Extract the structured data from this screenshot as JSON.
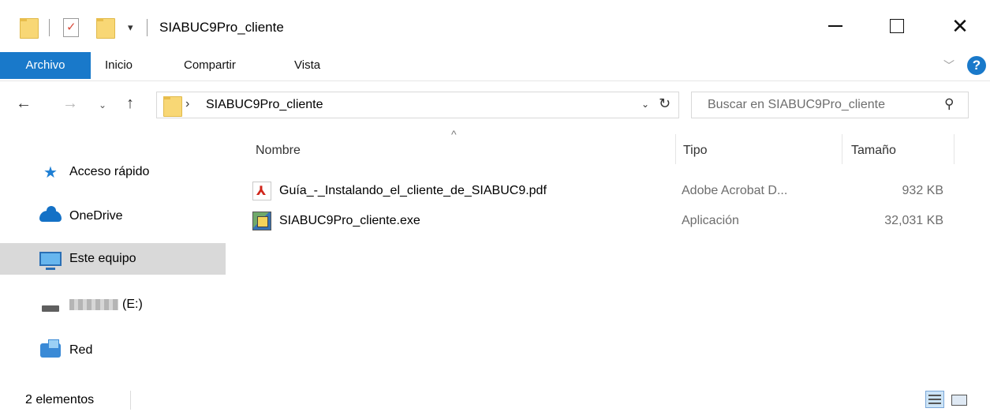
{
  "window": {
    "title": "SIABUC9Pro_cliente",
    "quick_access_dropdown": "▾",
    "minimize": "",
    "maximize": "",
    "close": "✕"
  },
  "ribbon": {
    "tabs": [
      {
        "label": "Archivo"
      },
      {
        "label": "Inicio"
      },
      {
        "label": "Compartir"
      },
      {
        "label": "Vista"
      }
    ],
    "expand": "﹀",
    "help": "?"
  },
  "nav": {
    "back": "←",
    "forward": "→",
    "recent": "⌄",
    "up": "↑",
    "breadcrumb_separator": "›",
    "address": "SIABUC9Pro_cliente",
    "address_dropdown": "⌄",
    "refresh": "↻",
    "search_placeholder": "Buscar en SIABUC9Pro_cliente",
    "search_icon": "⚲"
  },
  "sidebar": {
    "items": [
      {
        "label": "Acceso rápido",
        "icon": "star-icon"
      },
      {
        "label": "OneDrive",
        "icon": "cloud-icon"
      },
      {
        "label": "Este equipo",
        "icon": "computer-icon",
        "selected": true
      },
      {
        "label": "(E:)",
        "icon": "drive-icon"
      },
      {
        "label": "Red",
        "icon": "network-icon"
      }
    ]
  },
  "columns": {
    "sort_indicator": "^",
    "name": "Nombre",
    "type": "Tipo",
    "size": "Tamaño"
  },
  "files": [
    {
      "name": "Guía_-_Instalando_el_cliente_de_SIABUC9.pdf",
      "type": "Adobe Acrobat D...",
      "size": "932 KB",
      "icon": "pdf-icon"
    },
    {
      "name": "SIABUC9Pro_cliente.exe",
      "type": "Aplicación",
      "size": "32,031 KB",
      "icon": "exe-icon"
    }
  ],
  "status": {
    "count": "2 elementos"
  },
  "colors": {
    "accent": "#1979ca",
    "selected_bg": "#d9d9d9"
  }
}
